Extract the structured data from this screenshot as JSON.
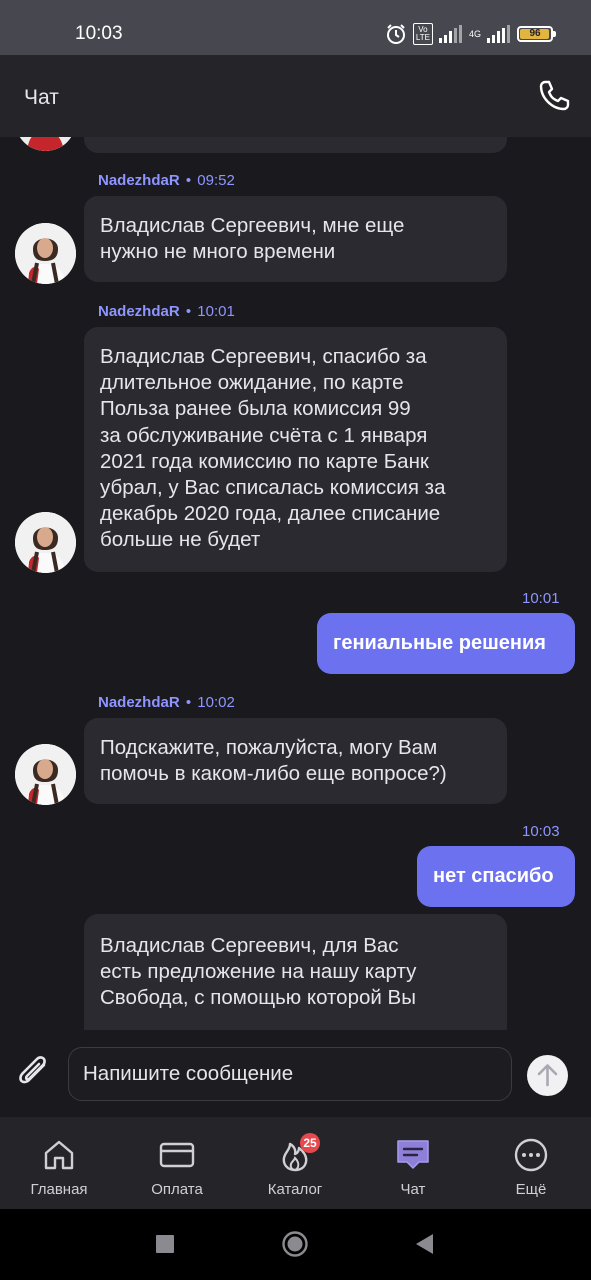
{
  "status_bar": {
    "time": "10:03",
    "volte": "Vo\nLTE",
    "network": "4G",
    "battery": "96",
    "battery_level": 0.96,
    "icons": [
      "alarm-icon",
      "volte-icon",
      "signal-icon",
      "signal-4g-icon",
      "battery-icon"
    ]
  },
  "header": {
    "title": "Чат",
    "call_icon": "phone-icon"
  },
  "messages": [
    {
      "direction": "in",
      "author": "NadezhdaR",
      "time": "09:52",
      "text": "Владислав Сергеевич, мне еще\nнужно не много времени"
    },
    {
      "direction": "in",
      "author": "NadezhdaR",
      "time": "10:01",
      "text": "Владислав Сергеевич, спасибо за\nдлительное ожидание, по карте\nПольза ранее была комиссия 99\nза обслуживание счёта с 1 января\n2021 года комиссию по карте Банк\nубрал, у Вас списалась комиссия за\nдекабрь 2020 года, далее списание\nбольше не будет"
    },
    {
      "direction": "out",
      "time": "10:01",
      "text": "гениальные решения"
    },
    {
      "direction": "in",
      "author": "NadezhdaR",
      "time": "10:02",
      "text": "Подскажите, пожалуйста, могу Вам\nпомочь в каком-либо еще вопросе?)"
    },
    {
      "direction": "out",
      "time": "10:03",
      "text": "нет спасибо"
    },
    {
      "direction": "in",
      "text": "Владислав Сергеевич, для Вас\nесть предложение на нашу карту\nСвобода, с помощью которой  Вы"
    }
  ],
  "composer": {
    "placeholder": "Напишите сообщение",
    "attach_icon": "paperclip-icon",
    "send_icon": "arrow-up-icon"
  },
  "bottom_nav": {
    "items": [
      {
        "label": "Главная",
        "icon": "home-icon"
      },
      {
        "label": "Оплата",
        "icon": "card-icon"
      },
      {
        "label": "Каталог",
        "icon": "flame-icon",
        "badge": "25"
      },
      {
        "label": "Чат",
        "icon": "chat-icon",
        "active": true
      },
      {
        "label": "Ещё",
        "icon": "more-icon"
      }
    ]
  },
  "colors": {
    "accent": "#6c72ef",
    "accent_text": "#8f95ff",
    "background": "#19191e",
    "bubble_in": "#2a2a30",
    "badge": "#e5484d"
  }
}
